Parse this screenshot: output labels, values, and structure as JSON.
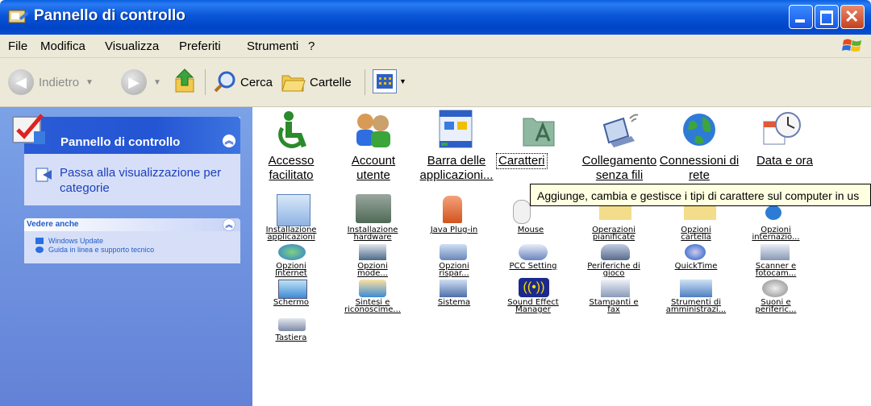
{
  "window": {
    "title": "Pannello di controllo",
    "title_icon": "control-panel-icon"
  },
  "menu": [
    "File",
    "Modifica",
    "Visualizza",
    "Preferiti",
    "Strumenti",
    "?"
  ],
  "toolbar": {
    "back": "Indietro",
    "search": "Cerca",
    "folders": "Cartelle"
  },
  "sidebar": {
    "panel_title": "Pannello di controllo",
    "switch_view": "Passa alla visualizzazione per categorie",
    "see_also_title": "Vedere anche",
    "see_also_items": [
      "Windows Update",
      "Guida in linea e supporto tecnico"
    ]
  },
  "icons_large": [
    {
      "label1": "Accesso",
      "label2": "facilitato",
      "icon": "accessibility-icon"
    },
    {
      "label1": "Account",
      "label2": "utente",
      "icon": "user-accounts-icon"
    },
    {
      "label1": "Barra delle",
      "label2": "applicazioni...",
      "icon": "taskbar-icon"
    },
    {
      "label1": "Caratteri",
      "label2": "",
      "icon": "fonts-folder-icon"
    },
    {
      "label1": "Collegamento",
      "label2": "senza fili",
      "icon": "wireless-icon"
    },
    {
      "label1": "Connessioni di",
      "label2": "rete",
      "icon": "network-globe-icon"
    },
    {
      "label1": "Data e ora",
      "label2": "",
      "icon": "clock-icon"
    }
  ],
  "icons_small": [
    {
      "l1": "Installazione",
      "l2": "applicazioni"
    },
    {
      "l1": "Installazione",
      "l2": "hardware"
    },
    {
      "l1": "Java Plug-in",
      "l2": ""
    },
    {
      "l1": "Mouse",
      "l2": ""
    },
    {
      "l1": "Operazioni",
      "l2": "pianificate"
    },
    {
      "l1": "Opzioni",
      "l2": "cartella"
    },
    {
      "l1": "Opzioni",
      "l2": "internazio..."
    },
    {
      "l1": "Opzioni",
      "l2": "Internet"
    },
    {
      "l1": "Opzioni",
      "l2": "mode..."
    },
    {
      "l1": "Opzioni",
      "l2": "rispar..."
    },
    {
      "l1": "PCC Setting",
      "l2": ""
    },
    {
      "l1": "Periferiche di",
      "l2": "gioco"
    },
    {
      "l1": "QuickTime",
      "l2": ""
    },
    {
      "l1": "Scanner e",
      "l2": "fotocam..."
    },
    {
      "l1": "Schermo",
      "l2": ""
    },
    {
      "l1": "Sintesi e",
      "l2": "riconoscime..."
    },
    {
      "l1": "Sistema",
      "l2": ""
    },
    {
      "l1": "Sound Effect",
      "l2": "Manager"
    },
    {
      "l1": "Stampanti e",
      "l2": "fax"
    },
    {
      "l1": "Strumenti di",
      "l2": "amministrazi..."
    },
    {
      "l1": "Suoni e",
      "l2": "periferic..."
    },
    {
      "l1": "Tastiera",
      "l2": ""
    }
  ],
  "tooltip": "Aggiunge, cambia e gestisce i tipi di carattere sul computer in us",
  "colors": {
    "titlebar": "#0a56d8",
    "sidebar": "#6f93df",
    "tooltip_bg": "#ffffe1",
    "selection": "#316ac5"
  }
}
